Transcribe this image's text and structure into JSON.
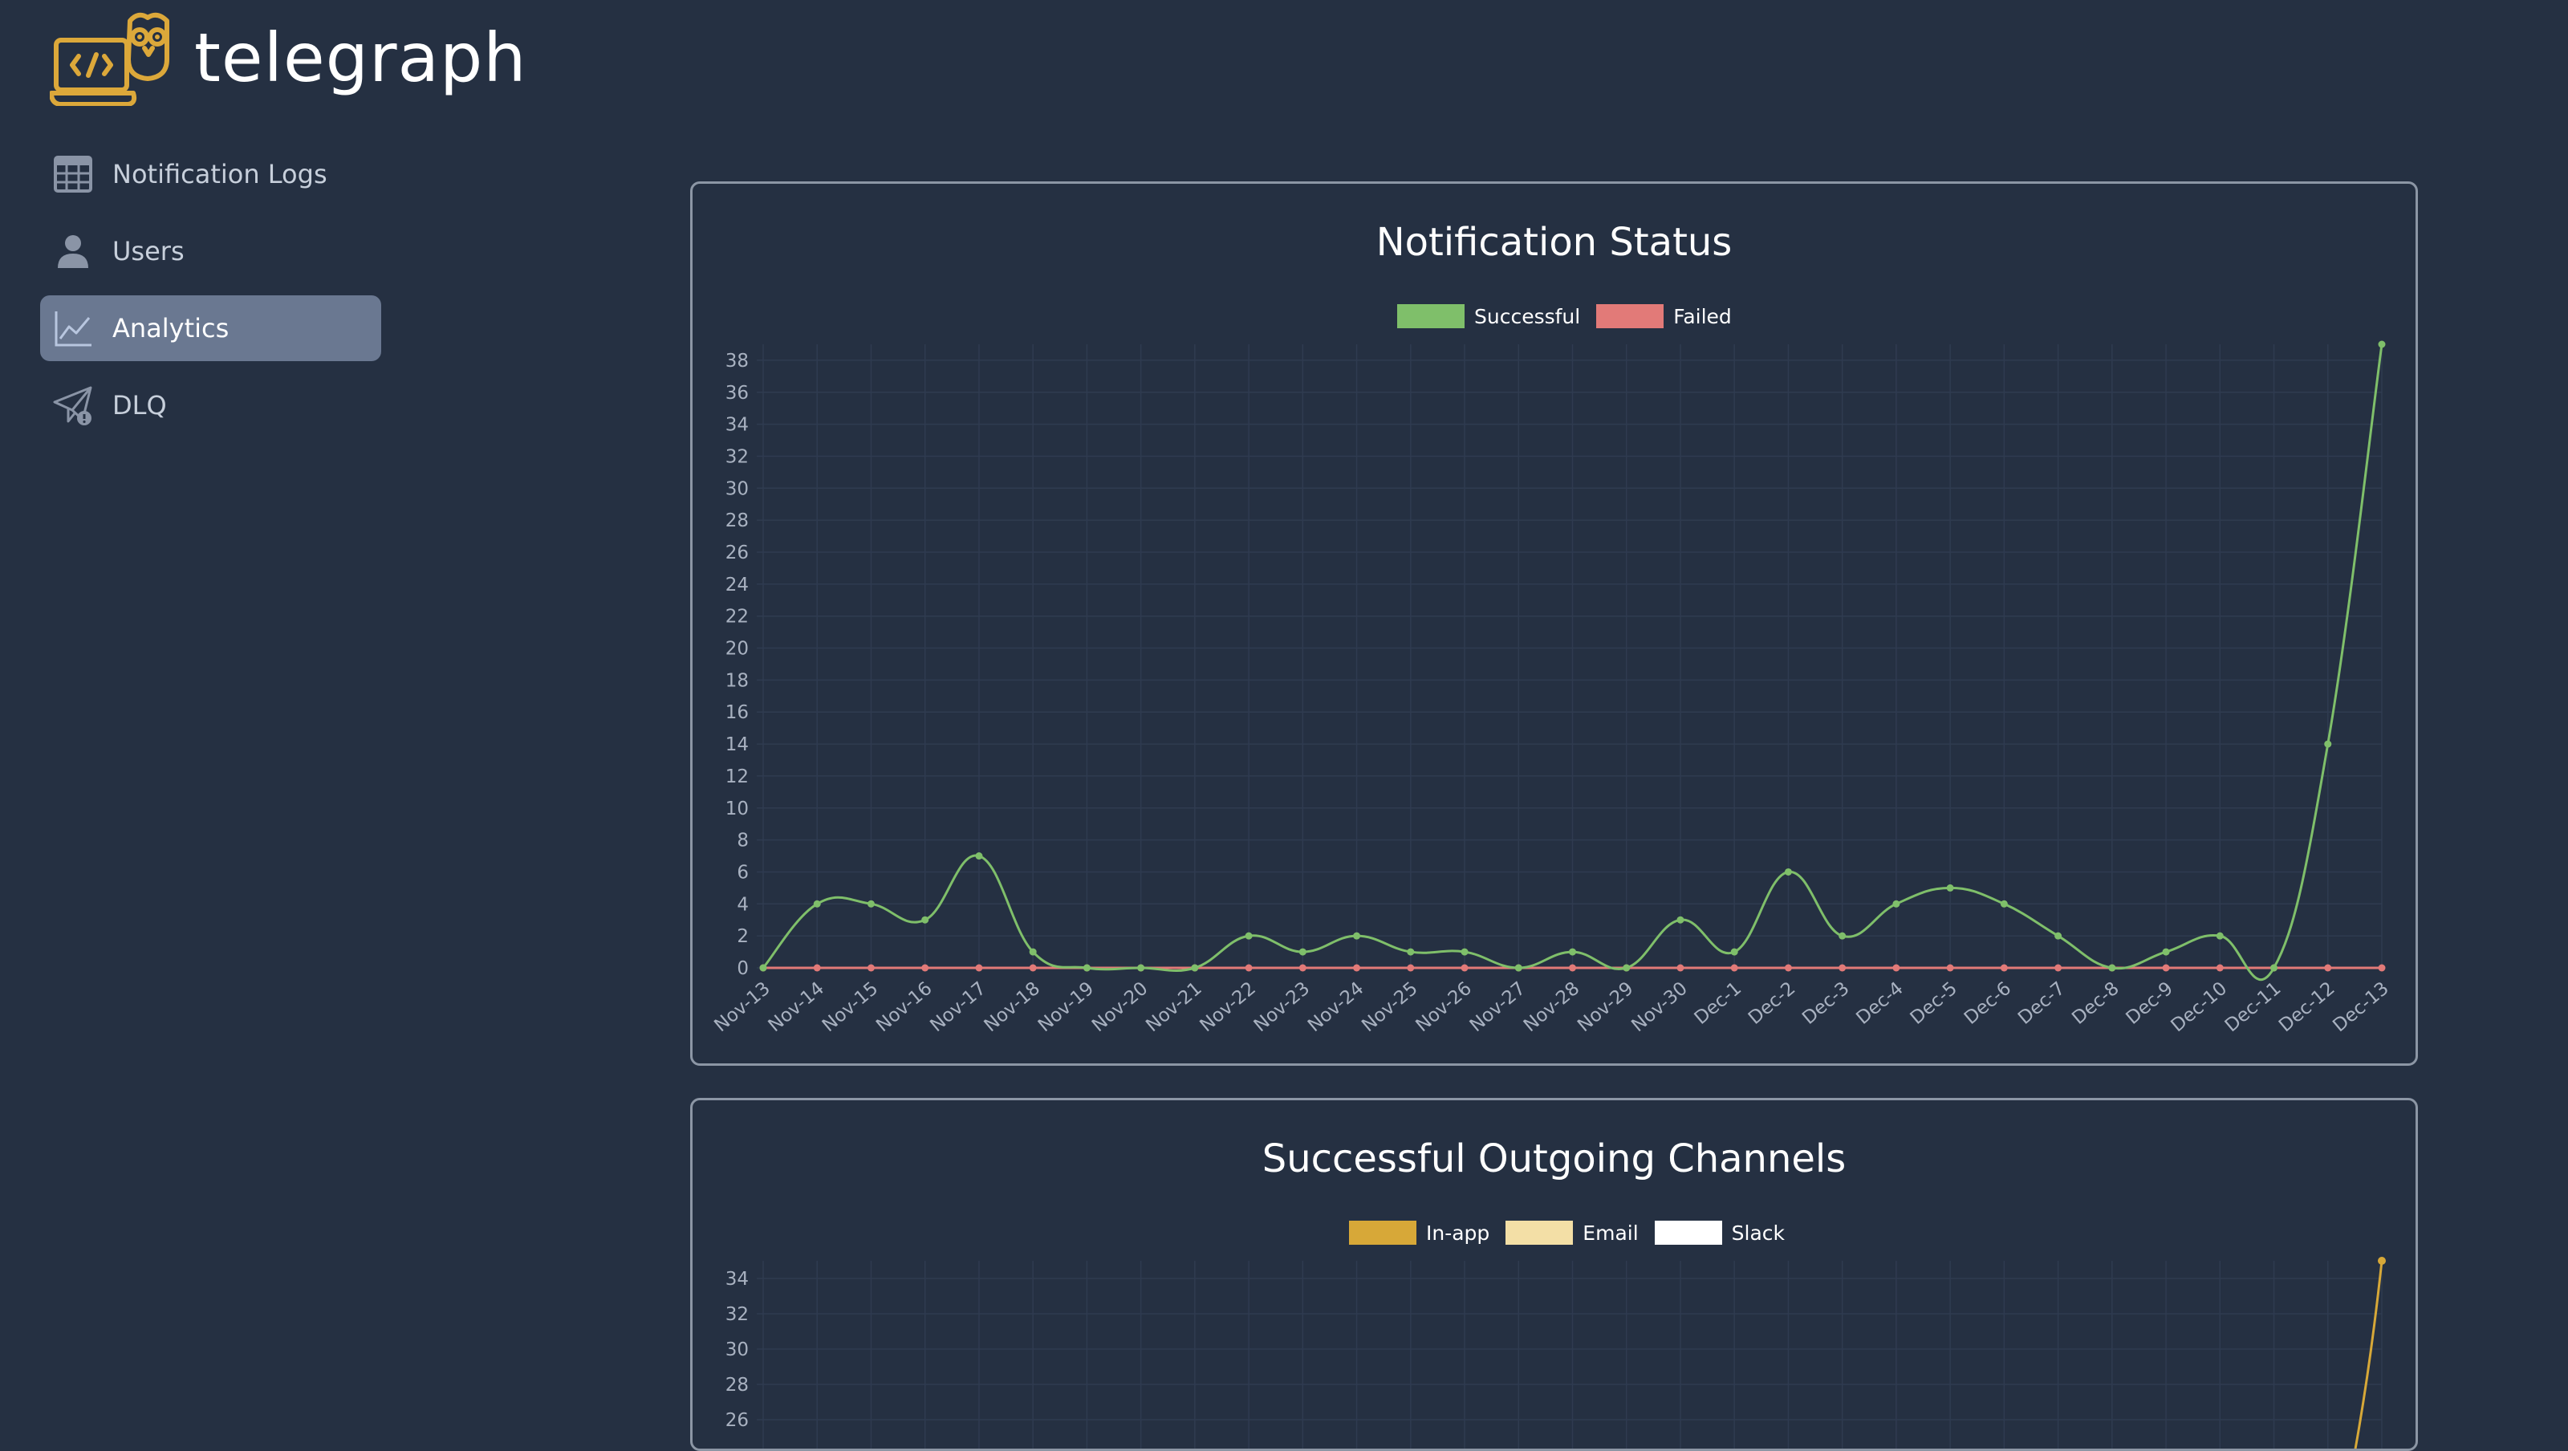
{
  "app": {
    "name": "telegraph"
  },
  "nav": {
    "items": [
      {
        "label": "Notification Logs",
        "icon": "table-icon",
        "active": false
      },
      {
        "label": "Users",
        "icon": "user-icon",
        "active": false
      },
      {
        "label": "Analytics",
        "icon": "chart-line-icon",
        "active": true
      },
      {
        "label": "DLQ",
        "icon": "paper-plane-alert-icon",
        "active": false
      }
    ]
  },
  "colors": {
    "background": "#253042",
    "accent": "#dca83a",
    "successful": "#7fbf6a",
    "failed": "#e27a78",
    "inapp": "#d7a838",
    "email": "#f3dfa6",
    "slack": "#ffffff"
  },
  "chart_data": [
    {
      "type": "line",
      "title": "Notification Status",
      "categories": [
        "Nov-13",
        "Nov-14",
        "Nov-15",
        "Nov-16",
        "Nov-17",
        "Nov-18",
        "Nov-19",
        "Nov-20",
        "Nov-21",
        "Nov-22",
        "Nov-23",
        "Nov-24",
        "Nov-25",
        "Nov-26",
        "Nov-27",
        "Nov-28",
        "Nov-29",
        "Nov-30",
        "Dec-1",
        "Dec-2",
        "Dec-3",
        "Dec-4",
        "Dec-5",
        "Dec-6",
        "Dec-7",
        "Dec-8",
        "Dec-9",
        "Dec-10",
        "Dec-11",
        "Dec-12",
        "Dec-13"
      ],
      "series": [
        {
          "name": "Successful",
          "values": [
            0,
            4,
            4,
            3,
            7,
            1,
            0,
            0,
            0,
            2,
            1,
            2,
            1,
            1,
            0,
            1,
            0,
            3,
            1,
            6,
            2,
            4,
            5,
            4,
            2,
            0,
            1,
            2,
            0,
            14,
            39
          ]
        },
        {
          "name": "Failed",
          "values": [
            0,
            0,
            0,
            0,
            0,
            0,
            0,
            0,
            0,
            0,
            0,
            0,
            0,
            0,
            0,
            0,
            0,
            0,
            0,
            0,
            0,
            0,
            0,
            0,
            0,
            0,
            0,
            0,
            0,
            0,
            0
          ]
        }
      ],
      "yticks": [
        0,
        2,
        4,
        6,
        8,
        10,
        12,
        14,
        16,
        18,
        20,
        22,
        24,
        26,
        28,
        30,
        32,
        34,
        36,
        38
      ],
      "ylim": [
        0,
        39
      ],
      "legend": "top-center",
      "grid": true
    },
    {
      "type": "line",
      "title": "Successful Outgoing Channels",
      "series": [
        {
          "name": "In-app"
        },
        {
          "name": "Email"
        },
        {
          "name": "Slack"
        }
      ],
      "yticks_visible": [
        34,
        32,
        30,
        28,
        26
      ],
      "visible_point": {
        "category": "Dec-13",
        "series": "In-app",
        "value": 35
      },
      "legend": "top-center",
      "grid": true
    }
  ]
}
